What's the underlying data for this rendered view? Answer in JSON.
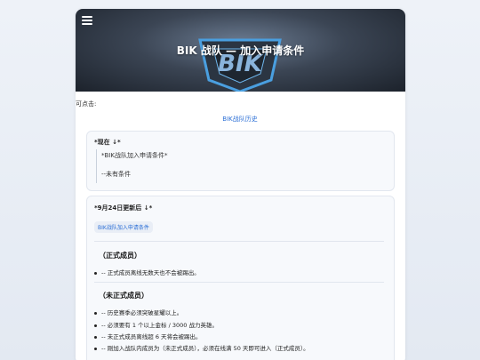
{
  "header": {
    "title": "BIK 战队 — 加入申请条件",
    "logo_text": "BIK"
  },
  "intro": {
    "clickable_label": "可点击:",
    "history_link": "BIK战队历史"
  },
  "now_section": {
    "heading": "*现在 ↓*",
    "quote_line1": "*BIK战队加入申请条件*",
    "quote_line2": "--未有条件"
  },
  "update_section": {
    "heading": "*9月24日更新后 ↓*",
    "tag": "BIK战队加入申请条件",
    "official": {
      "heading": "（正式成员）",
      "items": [
        "-- 正式成员离线无数天也不会被踢出。"
      ]
    },
    "unofficial": {
      "heading": "（未正式成员）",
      "items": [
        "-- 历史赛季必须突破星耀以上。",
        "-- 必须要有 1 个以上金标 / 3000 战力英雄。",
        "-- 未正式成员离线超 6 天将会被踢出。",
        "-- 刚加入战队内成员为（未正式成员），必须在线满 50 天即可进入（正式成员）。"
      ]
    }
  },
  "colors": {
    "accent": "#2b6fd6",
    "page_bg": "#e3e9f2",
    "card_bg": "#ffffff"
  }
}
